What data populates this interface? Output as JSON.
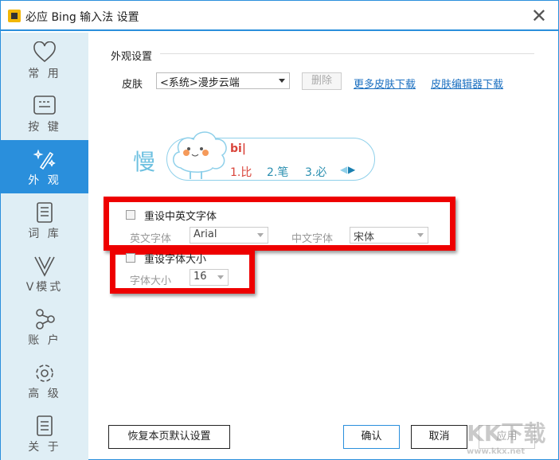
{
  "window": {
    "title": "必应 Bing 输入法 设置",
    "close": "✕"
  },
  "sidebar": {
    "items": [
      {
        "label": "常 用",
        "icon": "heart-icon"
      },
      {
        "label": "按 键",
        "icon": "keyboard-icon"
      },
      {
        "label": "外 观",
        "icon": "magic-wand-icon",
        "active": true
      },
      {
        "label": "词 库",
        "icon": "book-icon"
      },
      {
        "label": "V模式",
        "icon": "v-mode-icon"
      },
      {
        "label": "账 户",
        "icon": "share-nodes-icon"
      },
      {
        "label": "高 级",
        "icon": "gear-icon"
      },
      {
        "label": "关 于",
        "icon": "document-icon"
      }
    ]
  },
  "main": {
    "section_title": "外观设置",
    "skin": {
      "label": "皮肤",
      "value": "<系统>漫步云端",
      "delete": "删除",
      "more_link": "更多皮肤下载",
      "editor_link": "皮肤编辑器下载"
    },
    "preview": {
      "mode_char": "慢",
      "composition": "bi|",
      "candidates": [
        "1.比",
        "2.笔",
        "3.必"
      ]
    },
    "font_reset": {
      "checkbox_label": "重设中英文字体",
      "checked": false,
      "en_label": "英文字体",
      "en_value": "Arial",
      "zh_label": "中文字体",
      "zh_value": "宋体"
    },
    "size_reset": {
      "checkbox_label": "重设字体大小",
      "checked": false,
      "size_label": "字体大小",
      "size_value": "16"
    }
  },
  "footer": {
    "restore": "恢复本页默认设置",
    "ok": "确认",
    "cancel": "取消",
    "apply": "应用"
  },
  "watermark": {
    "logo": "KK下载",
    "url": "www.kkx.net"
  },
  "colors": {
    "accent": "#2a8fdc",
    "highlight": "#ee0000",
    "sidebar": "#dfeef5"
  }
}
